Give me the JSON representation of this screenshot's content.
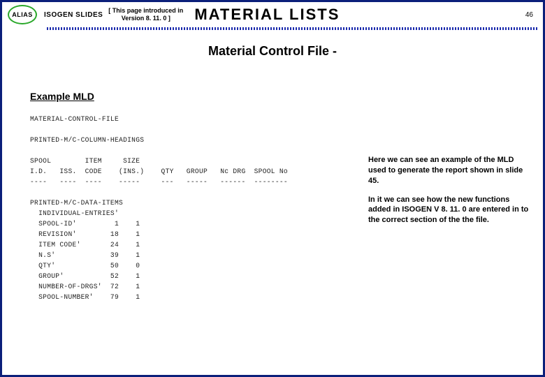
{
  "header": {
    "badge": "ALIAS",
    "isogen": "ISOGEN SLIDES",
    "version_line1": "[ This page introduced in",
    "version_line2": "Version 8. 11. 0 ]",
    "title": "MATERIAL LISTS",
    "page_number": "46"
  },
  "subtitle": "Material Control File -",
  "example_heading": "Example MLD",
  "mld_text": "MATERIAL-CONTROL-FILE\n\nPRINTED-M/C-COLUMN-HEADINGS\n\nSPOOL        ITEM     SIZE\nI.D.   ISS.  CODE    (INS.)    QTY   GROUP   Nc DRG  SPOOL No\n----   ----  ----    -----     ---   -----   ------  --------\n\nPRINTED-M/C-DATA-ITEMS\n  INDIVIDUAL-ENTRIES'\n  SPOOL-ID'         1    1\n  REVISION'        18    1\n  ITEM CODE'       24    1\n  N.S'             39    1\n  QTY'             50    0\n  GROUP'           52    1\n  NUMBER-OF-DRGS'  72    1\n  SPOOL-NUMBER'    79    1",
  "explanation": {
    "p1": "Here we can see an example of the MLD used to generate the report shown in slide 45.",
    "p2": "In it we can see how the new functions added in ISOGEN V 8. 11. 0 are entered in to the correct section of the the file."
  }
}
